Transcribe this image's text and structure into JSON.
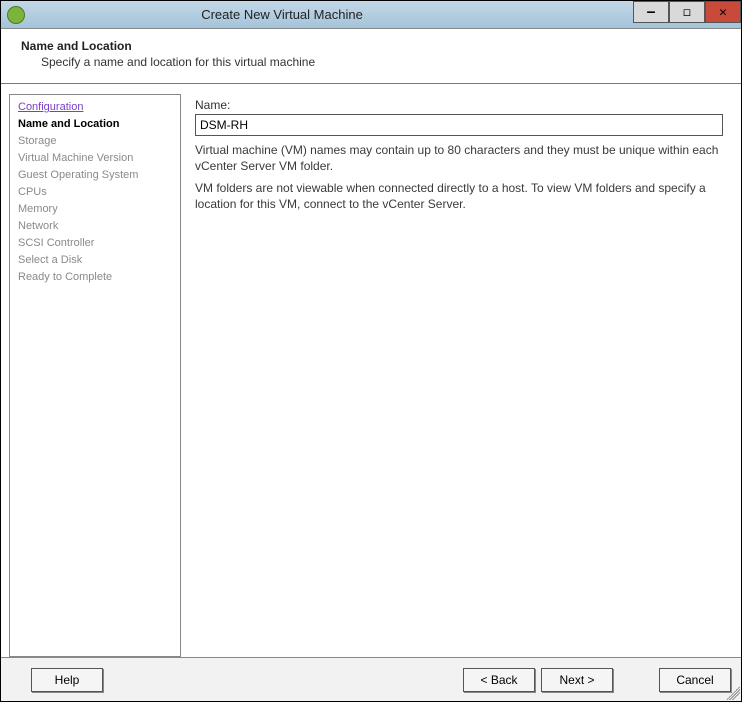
{
  "titlebar": {
    "title": "Create New Virtual Machine"
  },
  "header": {
    "title": "Name and Location",
    "desc": "Specify a name and location for this virtual machine"
  },
  "sidebar": {
    "items": [
      {
        "label": "Configuration",
        "state": "link"
      },
      {
        "label": "Name and Location",
        "state": "active"
      },
      {
        "label": "Storage",
        "state": "disabled"
      },
      {
        "label": "Virtual Machine Version",
        "state": "disabled"
      },
      {
        "label": "Guest Operating System",
        "state": "disabled"
      },
      {
        "label": "CPUs",
        "state": "disabled"
      },
      {
        "label": "Memory",
        "state": "disabled"
      },
      {
        "label": "Network",
        "state": "disabled"
      },
      {
        "label": "SCSI Controller",
        "state": "disabled"
      },
      {
        "label": "Select a Disk",
        "state": "disabled"
      },
      {
        "label": "Ready to Complete",
        "state": "disabled"
      }
    ]
  },
  "main": {
    "name_label": "Name:",
    "name_value": "DSM-RH",
    "info1": "Virtual machine (VM) names may contain up to 80 characters and they must be unique within each vCenter Server VM folder.",
    "info2": "VM folders are not viewable when connected directly to a host. To view VM folders and specify a location for this VM, connect to the vCenter Server."
  },
  "footer": {
    "help": "Help",
    "back": "< Back",
    "next": "Next >",
    "cancel": "Cancel"
  }
}
